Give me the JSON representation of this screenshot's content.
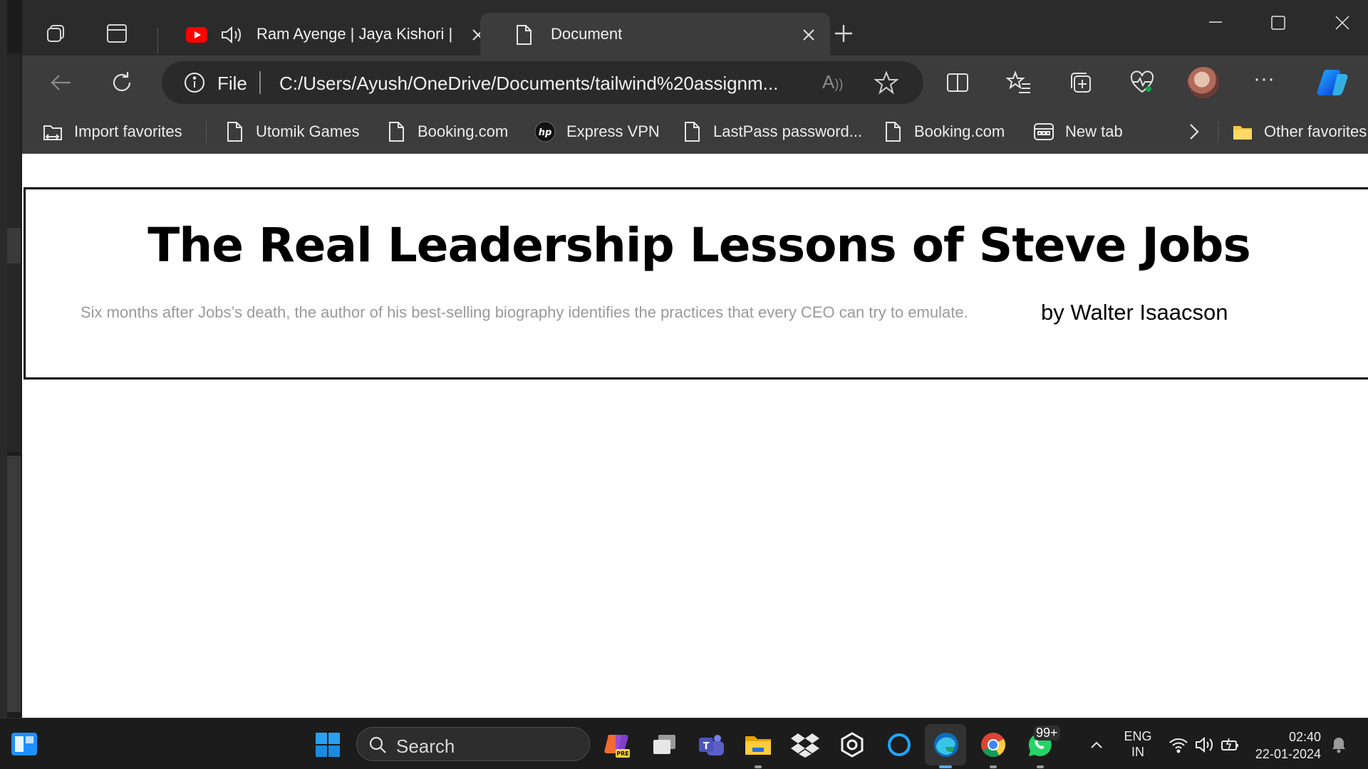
{
  "tabs": [
    {
      "label": "Ram Ayenge | Jaya Kishori |",
      "icon": "youtube-icon"
    },
    {
      "label": "Document",
      "icon": "document-icon",
      "active": true
    }
  ],
  "address_bar": {
    "scheme_label": "File",
    "url": "C:/Users/Ayush/OneDrive/Documents/tailwind%20assignm..."
  },
  "favorites": [
    {
      "label": "Import favorites",
      "icon": "import-icon"
    },
    {
      "label": "Utomik Games",
      "icon": "page-icon"
    },
    {
      "label": "Booking.com",
      "icon": "page-icon"
    },
    {
      "label": "Express VPN",
      "icon": "hp-logo-icon"
    },
    {
      "label": "LastPass password...",
      "icon": "page-icon"
    },
    {
      "label": "Booking.com",
      "icon": "page-icon"
    },
    {
      "label": "New tab",
      "icon": "new-tab-icon"
    },
    {
      "label": "Other favorites",
      "icon": "folder-icon"
    }
  ],
  "article": {
    "title": "The Real Leadership Lessons of Steve Jobs",
    "subtitle": "Six months after Jobs’s death, the author of his best-selling biography identifies the practices that every CEO can try to emulate.",
    "byline": "by Walter Isaacson"
  },
  "taskbar": {
    "search_label": "Search",
    "notification_badge": "99+",
    "language_line1": "ENG",
    "language_line2": "IN",
    "time": "02:40",
    "date": "22-01-2024"
  },
  "colors": {
    "tab_bar": "#2b2b2b",
    "toolbar": "#3c3c3c",
    "taskbar": "#1c1c1c",
    "youtube_red": "#ff0000",
    "edge_accent": "#0f6cbd"
  }
}
